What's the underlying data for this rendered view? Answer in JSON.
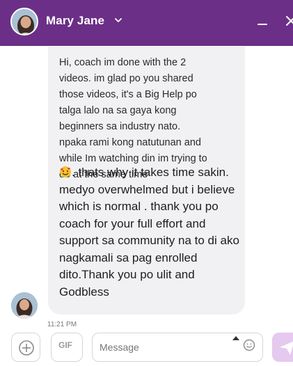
{
  "header": {
    "contact_name": "Mary Jane",
    "background_color": "#6b2f87"
  },
  "conversation": {
    "message_text_early": "Hi, coach im done with the 2 videos. im glad po you shared those videos, it's a Big Help po talga lalo na sa gaya kong beginners sa industry nato. npaka rami kong natutunan and while Im watching din im trying to do at the same time",
    "emoji_name": "smiling-face-with-hearts",
    "message_text_later": ". thats why it takes time sakin. medyo overwhelmed but i believe which is normal . thank you po coach for your full effort and support sa community na to di ako nagkamali sa pag enrolled dito.Thank you po ulit and Godbless",
    "timestamp": "11:21 PM",
    "bubble_color": "#f1f1f3"
  },
  "composer": {
    "gif_label": "GIF",
    "message_placeholder": "Message",
    "send_button_color": "#e6c9ef"
  }
}
